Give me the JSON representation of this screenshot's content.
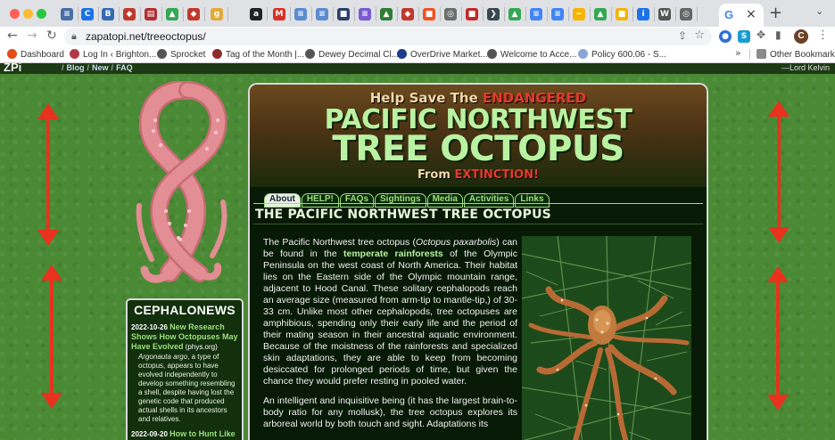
{
  "browser": {
    "url": "zapatopi.net/treeoctopus/",
    "active_tab_glyph": "G",
    "tab_favicons": [
      {
        "glyph": "≡",
        "color": "#4a6fa5"
      },
      {
        "glyph": "C",
        "color": "#1a73e8"
      },
      {
        "glyph": "B",
        "color": "#356ab3"
      },
      {
        "glyph": "◆",
        "color": "#c0392b"
      },
      {
        "glyph": "▤",
        "color": "#b03030"
      },
      {
        "glyph": "▲",
        "color": "#34a853"
      },
      {
        "glyph": "◆",
        "color": "#c0392b"
      },
      {
        "glyph": "g",
        "color": "#e2a93b"
      },
      {
        "glyph": "a",
        "color": "#222222"
      },
      {
        "glyph": "M",
        "color": "#d93025"
      },
      {
        "glyph": "≡",
        "color": "#5b8bd0"
      },
      {
        "glyph": "≡",
        "color": "#5b8bd0"
      },
      {
        "glyph": "■",
        "color": "#2a3f6e"
      },
      {
        "glyph": "≡",
        "color": "#7a5bd0"
      },
      {
        "glyph": "▲",
        "color": "#2e7d32"
      },
      {
        "glyph": "◆",
        "color": "#c0392b"
      },
      {
        "glyph": "■",
        "color": "#f4511e"
      },
      {
        "glyph": "◎",
        "color": "#6d6d6d"
      },
      {
        "glyph": "■",
        "color": "#c62828"
      },
      {
        "glyph": "❯",
        "color": "#37474f"
      },
      {
        "glyph": "▲",
        "color": "#34a853"
      },
      {
        "glyph": "≡",
        "color": "#4285f4"
      },
      {
        "glyph": "≡",
        "color": "#4285f4"
      },
      {
        "glyph": "−",
        "color": "#f4b400"
      },
      {
        "glyph": "▲",
        "color": "#34a853"
      },
      {
        "glyph": "■",
        "color": "#f4b400"
      },
      {
        "glyph": "i",
        "color": "#1a73e8"
      },
      {
        "glyph": "W",
        "color": "#555555"
      },
      {
        "glyph": "◎",
        "color": "#666666"
      }
    ],
    "extensions": [
      {
        "glyph": "●",
        "color": "#2e6fdb"
      },
      {
        "glyph": "S",
        "color": "#1b9bd1"
      }
    ],
    "avatar_initial": "C",
    "bookmarks": [
      {
        "label": "Dashboard",
        "color": "#e64a19"
      },
      {
        "label": "Log In ‹ Brighton...",
        "color": "#b23a48"
      },
      {
        "label": "Sprocket",
        "color": "#555555"
      },
      {
        "label": "Tag of the Month |...",
        "color": "#8e2b2b"
      },
      {
        "label": "Dewey Decimal Cl...",
        "color": "#555555"
      },
      {
        "label": "OverDrive Market...",
        "color": "#1c3d8c"
      },
      {
        "label": "Welcome to Acce...",
        "color": "#555555"
      },
      {
        "label": "Policy 600.06 - S...",
        "color": "#8aa6d8"
      }
    ],
    "bookmarks_more": "»",
    "other_bookmarks": "Other Bookmarks"
  },
  "site": {
    "logo": "ZPi",
    "crumbs": [
      "Blog",
      "New",
      "FAQ"
    ],
    "quote_attribution": "—Lord Kelvin"
  },
  "banner": {
    "tagline_pre": "Help Save The",
    "tagline_red": "ENDANGERED",
    "title_line1": "PACIFIC NORTHWEST",
    "title_line2": "TREE OCTOPUS",
    "from_pre": "From",
    "from_red": "EXTINCTION!"
  },
  "tabs": [
    "About",
    "HELP!",
    "FAQs",
    "Sightings",
    "Media",
    "Activities",
    "Links"
  ],
  "active_tab": "About",
  "page_heading": "THE PACIFIC NORTHWEST TREE OCTOPUS",
  "article": {
    "p1_a": "The Pacific Northwest tree octopus (",
    "p1_sci": "Octopus paxarbolis",
    "p1_b": ") can be found in the ",
    "p1_link": "temperate rainforests",
    "p1_c": " of the Olympic Peninsula on the west coast of North America. Their habitat lies on the Eastern side of the Olympic mountain range, adjacent to Hood Canal. These solitary cephalopods reach an average size (measured from arm-tip to mantle-tip,) of 30-33 cm. Unlike most other cephalopods, tree octopuses are amphibious, spending only their early life and the period of their mating season in their ancestral aquatic environment. Because of the moistness of the rainforests and specialized skin adaptations, they are able to keep from becoming desiccated for prolonged periods of time, but given the chance they would prefer resting in pooled water.",
    "p2": "An intelligent and inquisitive being (it has the largest brain-to-body ratio for any mollusk), the tree octopus explores its arboreal world by both touch and sight. Adaptations its"
  },
  "news": {
    "title": "CEPHALONEWS",
    "items": [
      {
        "date": "2022-10-26",
        "headline": "New Research Shows How Octopuses May Have Evolved",
        "source": "(phys.org)",
        "body_italic": "Argonauta argo",
        "body": ", a type of octopus, appears to have evolved independently to develop something resembling a shell, despite having lost the genetic code that produced actual shells in its ancestors and relatives."
      },
      {
        "date": "2022-09-20",
        "headline": "How to Hunt Like",
        "source": "",
        "body_italic": "",
        "body": ""
      }
    ]
  },
  "colors": {
    "arrow_red": "#e8321e",
    "octopus_pink": "#e38d94",
    "title_green": "#b9f2a2",
    "accent_red": "#e83a2a"
  }
}
